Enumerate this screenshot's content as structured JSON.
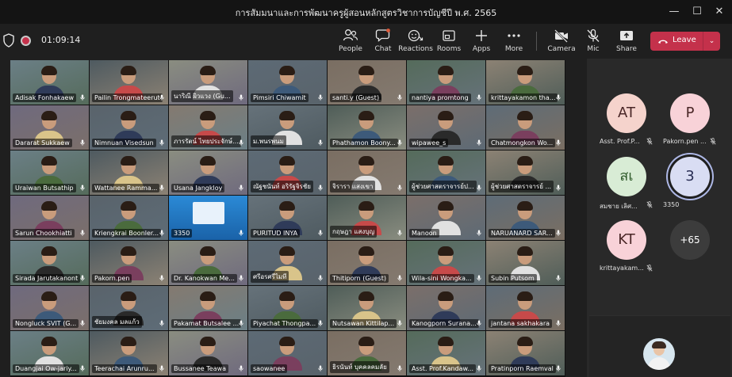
{
  "window": {
    "title": "การสัมมนาและการพัฒนาครูผู้สอนหลักสูตรวิชาการบัญชีปี พ.ศ. 2565",
    "minimize": "—",
    "maximize": "☐",
    "close": "✕"
  },
  "toolbar": {
    "timer": "01:09:14",
    "people": "People",
    "chat": "Chat",
    "reactions": "Reactions",
    "rooms": "Rooms",
    "apps": "Apps",
    "more": "More",
    "camera": "Camera",
    "mic": "Mic",
    "share": "Share",
    "leave": "Leave",
    "leave_caret": "⌄",
    "accent": "#c4314b"
  },
  "grid": {
    "tiles": [
      "Adisak Fonhakaew",
      "Pailin Trongmateerut",
      "นาริณี ผิวแวง (Gu...",
      "Pimsiri Chiwamit",
      "santi.y (Guest)",
      "nantiya promtong",
      "krittayakamon tha...",
      "Dararat Sukkaew",
      "Nimnuan Visedsun",
      "ภารรัตน์ ไทยประจักษ์...",
      "ม.พนรพนม",
      "Phathamon Boony...",
      "wipawee_s",
      "Chatmongkon Wo...",
      "Uraiwan Butsathip",
      "Wattanee Ramma...",
      "Usana Jangkloy",
      "ณัฐชนันท์ อริรัฐจิรชัย",
      "จิรารา แสงเขา",
      "ผู้ช่วยศาสตราจารย์ป...",
      "ผู้ช่วยศาสตราจารย์ ...",
      "Sarun Chookhiatti",
      "Kriengkrai Boonler...",
      "3350",
      "PURITUD INYA",
      "กฤษฎา แสงบุญ",
      "Manoon",
      "NARUANARD SAR...",
      "Sirada Jarutakanont",
      "Pakorn.pen",
      "Dr. Kanokwan Me...",
      "ศรีอรศรีไมที",
      "Thitiporn (Guest)",
      "Wila-sini Wongka...",
      "Subin Putsom",
      "Nongluck SVIT (G...",
      "ชัยมงคล มลแก้ว",
      "Pakamat Butsalee ...",
      "Piyachat Thongpa...",
      "Nutsawan Kittilap...",
      "Kanogporn Surana...",
      "jantana sakhakara",
      "Duangjai Ow-jariy...",
      "Teerachai Arunru...",
      "Bussanee Teawa",
      "saowanee",
      "ธิรนันท์ บุคคลคมลัย",
      "Asst. Prof.Kandaw...",
      "Pratinporn Raemval"
    ]
  },
  "sidebar": {
    "participants": [
      {
        "initials": "AT",
        "label": "Asst. Prof.P...",
        "color": "#f5d3cc"
      },
      {
        "initials": "P",
        "label": "Pakorn.pen ...",
        "color": "#f8d2d8"
      },
      {
        "initials": "สเ",
        "label": "สมชาย เลิศ...",
        "color": "#d8ecd5"
      },
      {
        "initials": "3",
        "label": "3350",
        "color": "#d9ddf3"
      },
      {
        "initials": "KT",
        "label": "krittayakam...",
        "color": "#f8d2d8"
      },
      {
        "initials": "+65",
        "label": "",
        "color": "#3c3c3c"
      }
    ]
  }
}
